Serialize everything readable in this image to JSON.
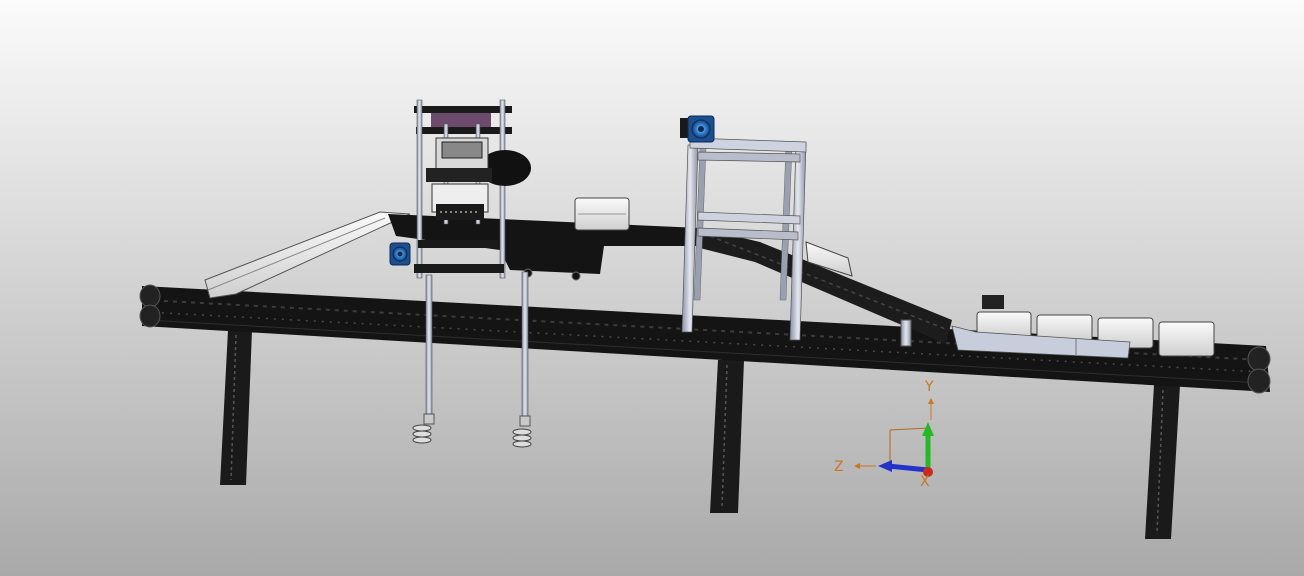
{
  "viewport": {
    "background_top": "#fbfbfb",
    "background_bottom": "#a9a9a9"
  },
  "triad": {
    "x_label": "X",
    "y_label": "Y",
    "z_label": "Z",
    "x_color": "#cc2a1a",
    "y_color": "#22bb22",
    "z_color": "#2233cc",
    "label_color": "#c8781e"
  },
  "model": {
    "frame_color": "#1a1a1a",
    "aluminum_color": "#b8bccb",
    "motor_color": "#2a78c8",
    "panel_color": "#e9e9e9"
  }
}
